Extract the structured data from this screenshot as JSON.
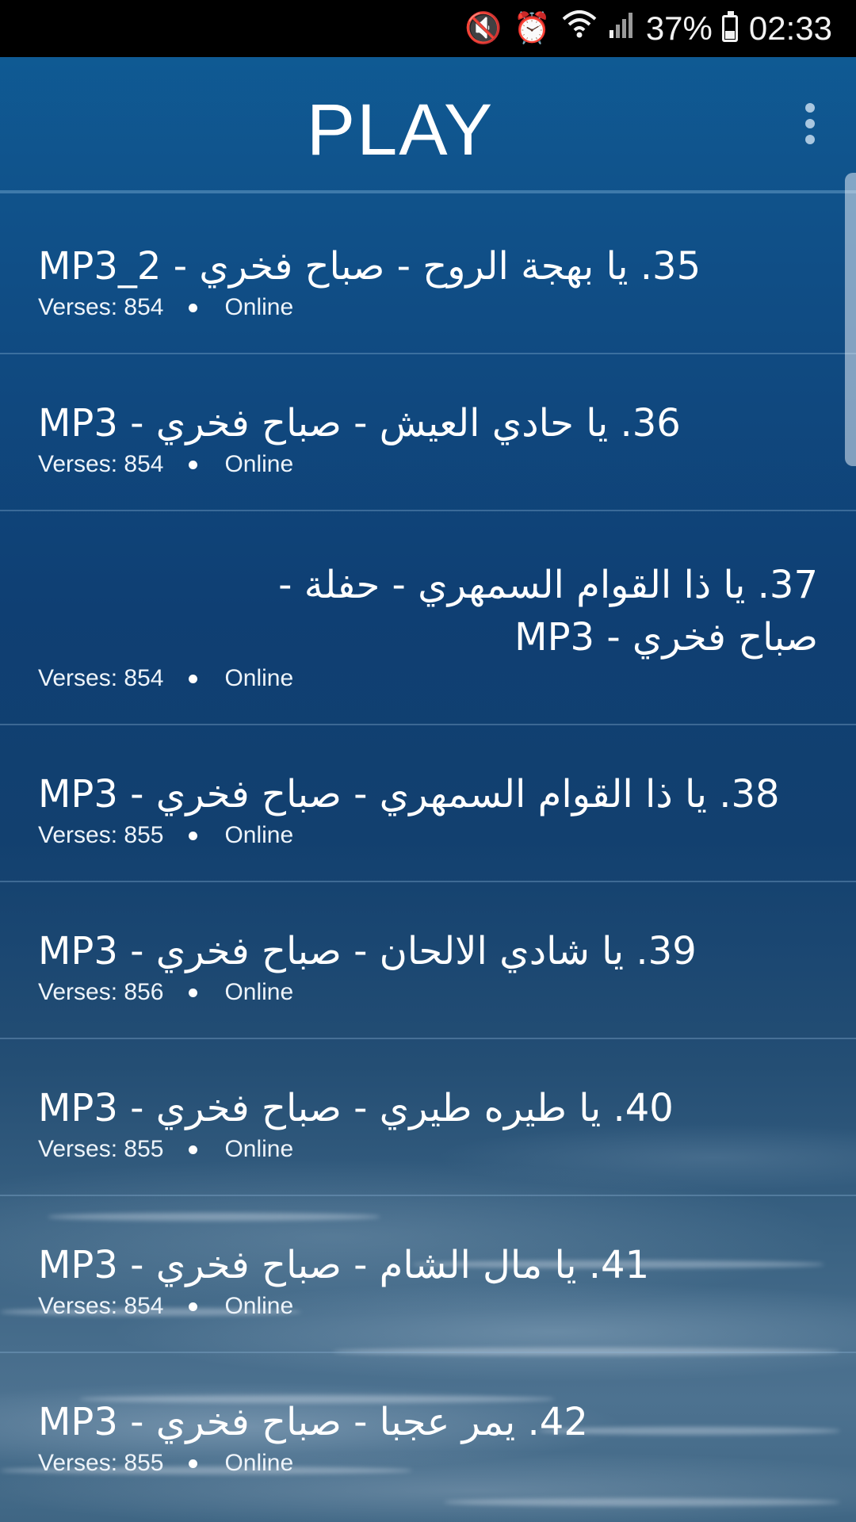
{
  "status_bar": {
    "mute_icon": "vibrate-mute-icon",
    "alarm_icon": "alarm-icon",
    "wifi_icon": "wifi-icon",
    "signal_icon": "signal-icon",
    "battery_percent": "37%",
    "time": "02:33"
  },
  "app_bar": {
    "title": "PLAY",
    "menu_icon": "overflow-menu-icon"
  },
  "tracks": [
    {
      "title": "35. يا بهجة الروح - صباح فخري - MP3_2",
      "verses": "Verses: 854",
      "status": "Online"
    },
    {
      "title": "36. يا حادي العيش - صباح فخري - MP3",
      "verses": "Verses: 854",
      "status": "Online"
    },
    {
      "title": "37. يا ذا القوام السمهري - حفلة - صباح فخري - MP3",
      "verses": "Verses: 854",
      "status": "Online"
    },
    {
      "title": "38. يا ذا القوام السمهري - صباح فخري - MP3",
      "verses": "Verses: 855",
      "status": "Online"
    },
    {
      "title": "39. يا شادي الالحان - صباح فخري - MP3",
      "verses": "Verses: 856",
      "status": "Online"
    },
    {
      "title": "40. يا طيره طيري - صباح فخري - MP3",
      "verses": "Verses: 855",
      "status": "Online"
    },
    {
      "title": "41. يا مال الشام - صباح فخري - MP3",
      "verses": "Verses: 854",
      "status": "Online"
    },
    {
      "title": "42. يمر عجبا - صباح فخري - MP3",
      "verses": "Verses: 855",
      "status": "Online"
    }
  ],
  "colors": {
    "status_bar_bg": "#000000",
    "app_bar_top": "#0f5d97",
    "text": "#ffffff"
  }
}
